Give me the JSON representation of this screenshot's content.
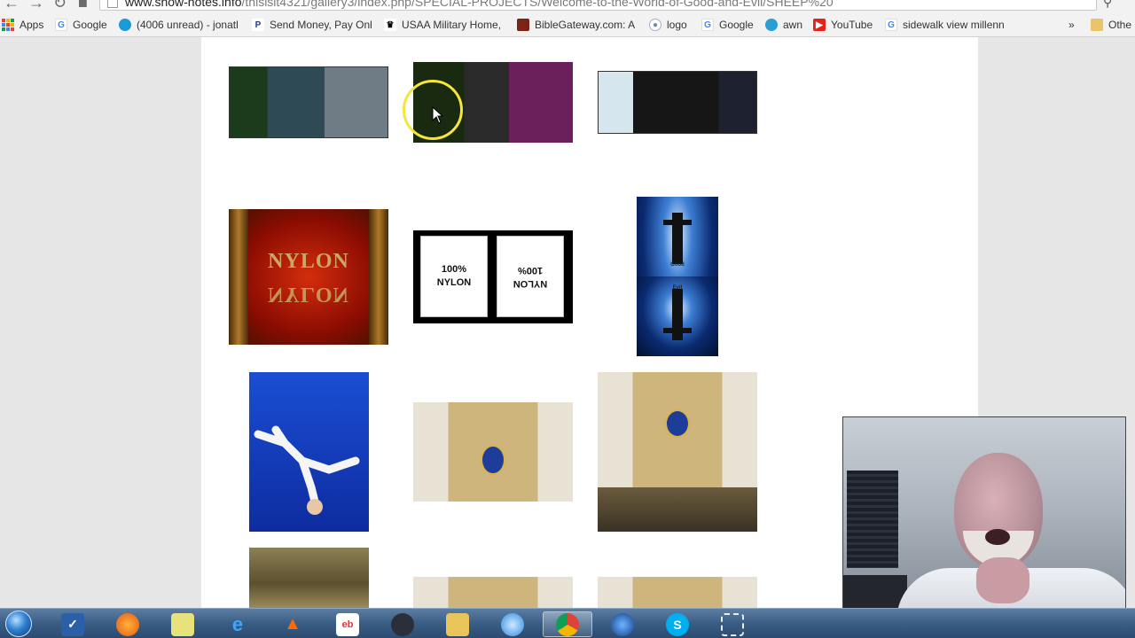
{
  "browser": {
    "url_host": "www.show-notes.info",
    "url_path": "/thisisit4321/gallery3/index.php/SPECIAL-PROJECTS/Welcome-to-the-World-of-Good-and-Evil/SHEEP%20",
    "bookmarks": [
      {
        "label": "Apps",
        "icon": "apps-grid-icon"
      },
      {
        "label": "Google",
        "icon": "google-icon"
      },
      {
        "label": "(4006 unread) - jonatl",
        "icon": "att-icon"
      },
      {
        "label": "Send Money, Pay Onli",
        "icon": "paypal-icon"
      },
      {
        "label": "USAA Military Home,",
        "icon": "usaa-icon"
      },
      {
        "label": "BibleGateway.com: A",
        "icon": "biblegateway-icon"
      },
      {
        "label": "logo",
        "icon": "globe-icon"
      },
      {
        "label": "Google",
        "icon": "google-icon"
      },
      {
        "label": "awn",
        "icon": "awn-icon"
      },
      {
        "label": "YouTube",
        "icon": "youtube-icon"
      },
      {
        "label": "sidewalk view millenn",
        "icon": "google-icon"
      },
      {
        "label": "»",
        "icon": "overflow-chevron-icon"
      },
      {
        "label": "Othe",
        "icon": "folder-icon"
      }
    ]
  },
  "gallery": {
    "nylon_top": "NYLON",
    "nylon_bottom": "NYLON",
    "panel_left": "100%\nNYLON",
    "panel_right": "NYLON\n100%",
    "cross_top": "Good",
    "cross_bottom": "Evil"
  },
  "taskbar": {
    "items": [
      {
        "icon": "start-orb-icon"
      },
      {
        "icon": "task-manager-icon"
      },
      {
        "icon": "firefox-icon"
      },
      {
        "icon": "sticky-notes-icon"
      },
      {
        "icon": "internet-explorer-icon"
      },
      {
        "icon": "flame-icon"
      },
      {
        "icon": "ebay-icon"
      },
      {
        "icon": "media-icon"
      },
      {
        "icon": "file-explorer-icon"
      },
      {
        "icon": "safari-compass-icon"
      },
      {
        "icon": "chrome-icon"
      },
      {
        "icon": "google-earth-icon"
      },
      {
        "icon": "skype-icon"
      },
      {
        "icon": "snipping-tool-icon"
      }
    ]
  },
  "colors": {
    "page_bg": "#ffffff",
    "desktop_bg": "#e6e6e6",
    "cursor_ring": "#f5e63a",
    "taskbar": "#3a5d85"
  }
}
